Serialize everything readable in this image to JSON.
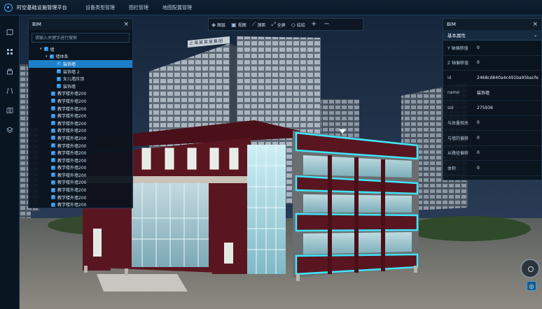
{
  "app": {
    "title": "时空基础设施管理平台"
  },
  "nav": {
    "tabs": [
      "设备类型管理",
      "图栏管理",
      "地图配置管理"
    ]
  },
  "rail": {
    "icons": [
      "map-icon",
      "grid-icon",
      "layers-stack-icon",
      "route-icon",
      "book-map-icon",
      "stack-icon"
    ]
  },
  "toolbar": {
    "layers": "图层",
    "view": "视图",
    "measure": "测距",
    "fullscreen": "全屏",
    "draw": "绘绘",
    "plus": "+",
    "minus": "−"
  },
  "left_panel": {
    "title": "BIM",
    "search_placeholder": "请输入关键字进行搜索",
    "tree": [
      {
        "label": "墙",
        "indent": 2,
        "arrow": true
      },
      {
        "label": "墙体条",
        "indent": 3,
        "arrow": true
      },
      {
        "label": "装饰墙",
        "indent": 4,
        "selected": true
      },
      {
        "label": "装饰墙 2",
        "indent": 4
      },
      {
        "label": "女儿墙压顶",
        "indent": 4
      },
      {
        "label": "装饰墙",
        "indent": 4
      },
      {
        "label": "教学楼外墙200",
        "indent": 3
      },
      {
        "label": "教学楼外墙200",
        "indent": 3
      },
      {
        "label": "教学楼外墙200",
        "indent": 3
      },
      {
        "label": "教学楼外墙200",
        "indent": 3
      },
      {
        "label": "教学楼外墙200",
        "indent": 3
      },
      {
        "label": "教学楼外墙200",
        "indent": 3
      },
      {
        "label": "教学楼外墙200",
        "indent": 3
      },
      {
        "label": "教学楼外墙200",
        "indent": 3
      },
      {
        "label": "教学楼外墙200",
        "indent": 3
      },
      {
        "label": "教学楼外墙200",
        "indent": 3
      },
      {
        "label": "教学楼外墙200",
        "indent": 3
      },
      {
        "label": "教学楼外墙200",
        "indent": 3
      },
      {
        "label": "教学楼外墙200",
        "indent": 3
      },
      {
        "label": "教学楼外墙200",
        "indent": 3
      },
      {
        "label": "教学楼外墙200",
        "indent": 3
      },
      {
        "label": "教学楼外墙200",
        "indent": 3
      }
    ]
  },
  "right_panel": {
    "title": "BIM",
    "section": "基本属性",
    "props": [
      {
        "key": "Y 轴偏移值",
        "value": "0"
      },
      {
        "key": "Z 轴偏移值",
        "value": "0"
      },
      {
        "key": "id",
        "value": "2468cd840a4c491ba95bacfe"
      },
      {
        "key": "name",
        "value": "装饰墙"
      },
      {
        "key": "sid",
        "value": "275936"
      },
      {
        "key": "与体量相关",
        "value": "0"
      },
      {
        "key": "与墙的偏移",
        "value": "0"
      },
      {
        "key": "从路径偏移",
        "value": "0"
      },
      {
        "key": "体积",
        "value": "0"
      }
    ]
  },
  "scene": {
    "billboard_text": "上海某某某集团",
    "colors": {
      "sky": "#1c2a40",
      "brick": "#5a1620",
      "highlight": "#3fe6ff",
      "glass": "#a8dde8",
      "ground": "#8a8680"
    }
  }
}
